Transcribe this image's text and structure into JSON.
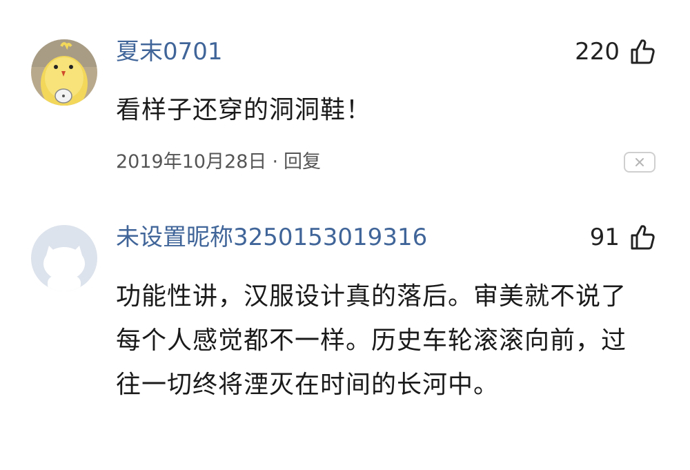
{
  "comments": [
    {
      "username": "夏末0701",
      "likes": "220",
      "content": "看样子还穿的洞洞鞋！",
      "date": "2019年10月28日",
      "separator": "·",
      "reply_label": "回复",
      "avatar": "yellow-chick-avatar"
    },
    {
      "username": "未设置昵称3250153019316",
      "likes": "91",
      "content": "功能性讲，汉服设计真的落后。审美就不说了每个人感觉都不一样。历史车轮滚滚向前，过往一切终将湮灭在时间的长河中。",
      "avatar": "default-avatar"
    }
  ],
  "colors": {
    "username": "#406599",
    "text": "#1a1a1a",
    "meta": "#555555"
  },
  "icons": {
    "like": "thumbs-up-icon",
    "close": "close-icon"
  }
}
